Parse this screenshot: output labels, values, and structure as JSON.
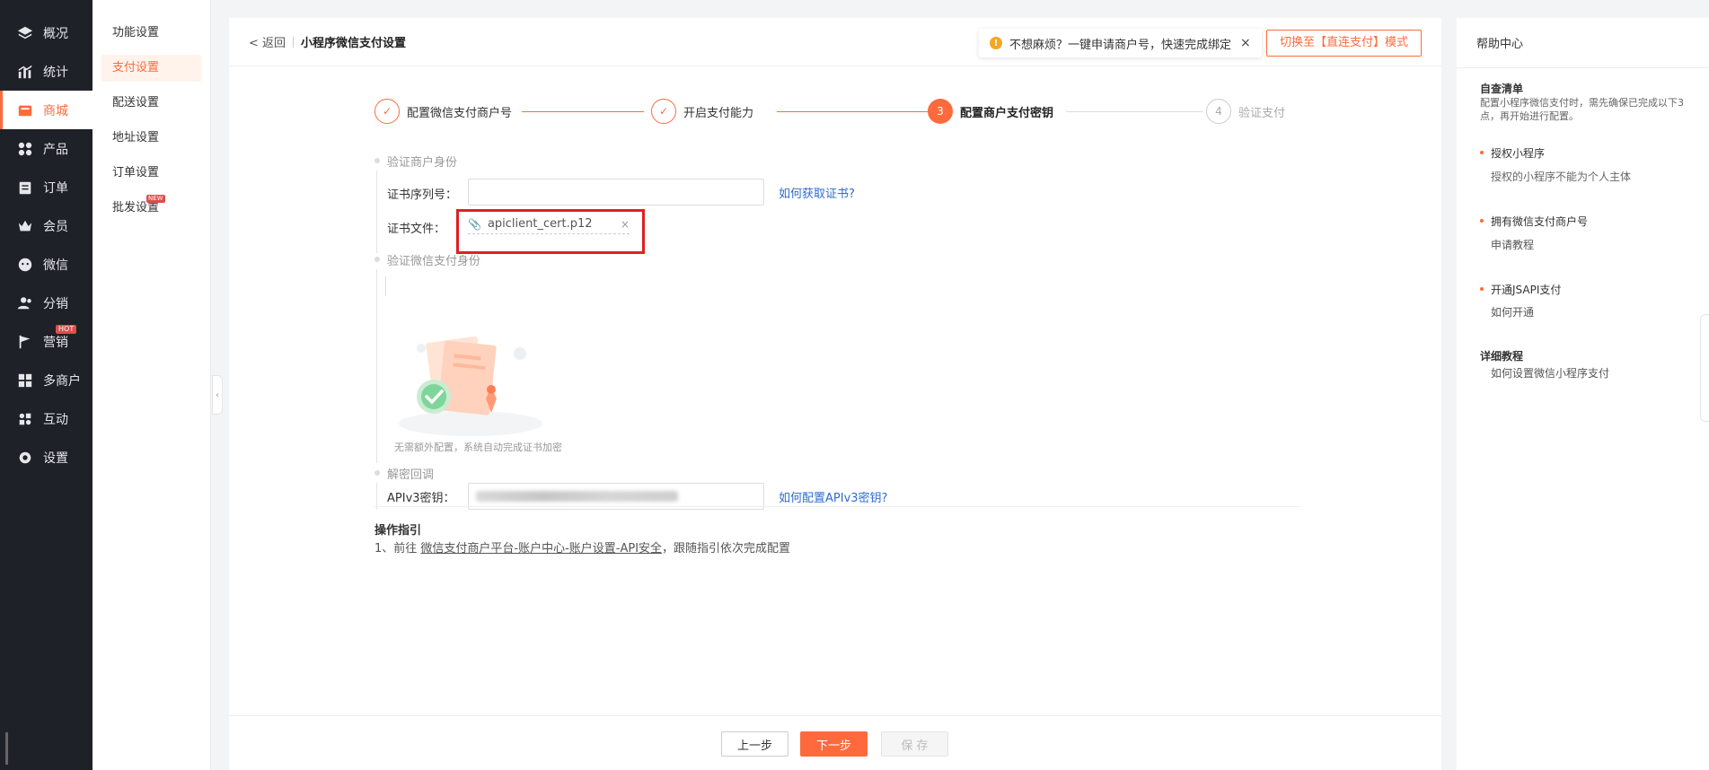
{
  "nav": {
    "items": [
      {
        "label": "概况",
        "icon": "layers-icon",
        "active": false
      },
      {
        "label": "统计",
        "icon": "chart-icon",
        "active": false
      },
      {
        "label": "商城",
        "icon": "shop-icon",
        "active": true
      },
      {
        "label": "产品",
        "icon": "grid-icon",
        "active": false
      },
      {
        "label": "订单",
        "icon": "clipboard-icon",
        "active": false
      },
      {
        "label": "会员",
        "icon": "crown-icon",
        "active": false
      },
      {
        "label": "微信",
        "icon": "wechat-icon",
        "active": false
      },
      {
        "label": "分销",
        "icon": "users-icon",
        "active": false
      },
      {
        "label": "营销",
        "icon": "flag-icon",
        "active": false,
        "badge": "HOT"
      },
      {
        "label": "多商户",
        "icon": "store-icon",
        "active": false
      },
      {
        "label": "互动",
        "icon": "apps-icon",
        "active": false
      },
      {
        "label": "设置",
        "icon": "gear-icon",
        "active": false
      }
    ]
  },
  "submenu": {
    "items": [
      {
        "label": "功能设置",
        "active": false
      },
      {
        "label": "支付设置",
        "active": true
      },
      {
        "label": "配送设置",
        "active": false
      },
      {
        "label": "地址设置",
        "active": false
      },
      {
        "label": "订单设置",
        "active": false
      },
      {
        "label": "批发设置",
        "active": false,
        "badge": "NEW"
      }
    ]
  },
  "header": {
    "back_label": "< 返回",
    "title": "小程序微信支付设置",
    "notice_text": "不想麻烦？一键申请商户号，快速完成绑定",
    "notice_close": "×",
    "switch_label": "切换至【直连支付】模式"
  },
  "steps": [
    {
      "num": "1",
      "label": "配置微信支付商户号",
      "state": "done"
    },
    {
      "num": "2",
      "label": "开启支付能力",
      "state": "done"
    },
    {
      "num": "3",
      "label": "配置商户支付密钥",
      "state": "current"
    },
    {
      "num": "4",
      "label": "验证支付",
      "state": "todo"
    }
  ],
  "form": {
    "section1_title": "验证商户身份",
    "cert_serial_label": "证书序列号：",
    "cert_serial_value": "",
    "cert_serial_help": "如何获取证书?",
    "cert_file_label": "证书文件：",
    "cert_file_name": "apiclient_cert.p12",
    "cert_file_remove": "×",
    "section2_title": "验证微信支付身份",
    "auto_hint": "无需额外配置，系统自动完成证书加密",
    "section3_title": "解密回调",
    "apiv3_label": "APIv3密钥：",
    "apiv3_help": "如何配置APIv3密钥?"
  },
  "guide": {
    "title": "操作指引",
    "prefix": "1、前往 ",
    "link": "微信支付商户平台-账户中心-账户设置-API安全",
    "suffix": "，跟随指引依次完成配置"
  },
  "footer": {
    "prev_label": "上一步",
    "next_label": "下一步",
    "save_label": "保 存"
  },
  "help": {
    "title": "帮助中心",
    "checklist_title": "自查清单",
    "checklist_desc": "配置小程序微信支付时，需先确保已完成以下3点，再开始进行配置。",
    "items": [
      {
        "label": "授权小程序",
        "detail": "授权的小程序不能为个人主体"
      },
      {
        "label": "拥有微信支付商户号",
        "detail": "申请教程"
      },
      {
        "label": "开通JSAPI支付",
        "detail": "如何开通"
      }
    ],
    "tutorial_title": "详细教程",
    "tutorial_link": "如何设置微信小程序支付"
  },
  "colors": {
    "accent": "#ff6a3d",
    "nav_bg": "#1f2128",
    "link": "#2f6bd1",
    "highlight": "#e02020"
  }
}
